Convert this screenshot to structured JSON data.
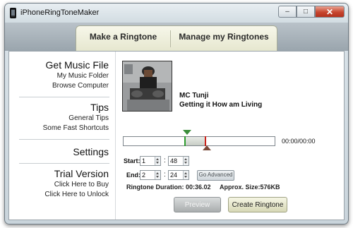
{
  "window": {
    "title": "iPhoneRingToneMaker",
    "controls": {
      "minimize": "–",
      "maximize": "□",
      "close": "✕"
    }
  },
  "tabs": [
    {
      "label": "Make a Ringtone"
    },
    {
      "label": "Manage my Ringtones"
    }
  ],
  "sidebar": {
    "sections": [
      {
        "heading": "Get Music File",
        "links": [
          "My Music Folder",
          "Browse Computer"
        ]
      },
      {
        "heading": "Tips",
        "links": [
          "General Tips",
          "Some Fast Shortcuts"
        ]
      },
      {
        "heading": "Settings",
        "links": []
      },
      {
        "heading": "Trial Version",
        "links": [
          "Click Here to Buy",
          "Click Here to Unlock"
        ]
      }
    ]
  },
  "track": {
    "artist": "MC Tunji",
    "song": "Getting it How am Living",
    "time_display": "00:00/00:00"
  },
  "editor": {
    "start_label": "Start:",
    "end_label": "End:",
    "start_min": "1",
    "start_sec": "48",
    "end_min": "2",
    "end_sec": "24",
    "colon": ":",
    "go_advanced": "Go Advanced",
    "duration": "Ringtone Duration: 00:36.02",
    "size": "Approx. Size:576KB"
  },
  "actions": {
    "preview": "Preview",
    "create": "Create Ringtone"
  },
  "icons": [
    "app-icon",
    "minimize-icon",
    "maximize-icon",
    "close-icon",
    "start-marker-icon",
    "end-marker-icon"
  ]
}
